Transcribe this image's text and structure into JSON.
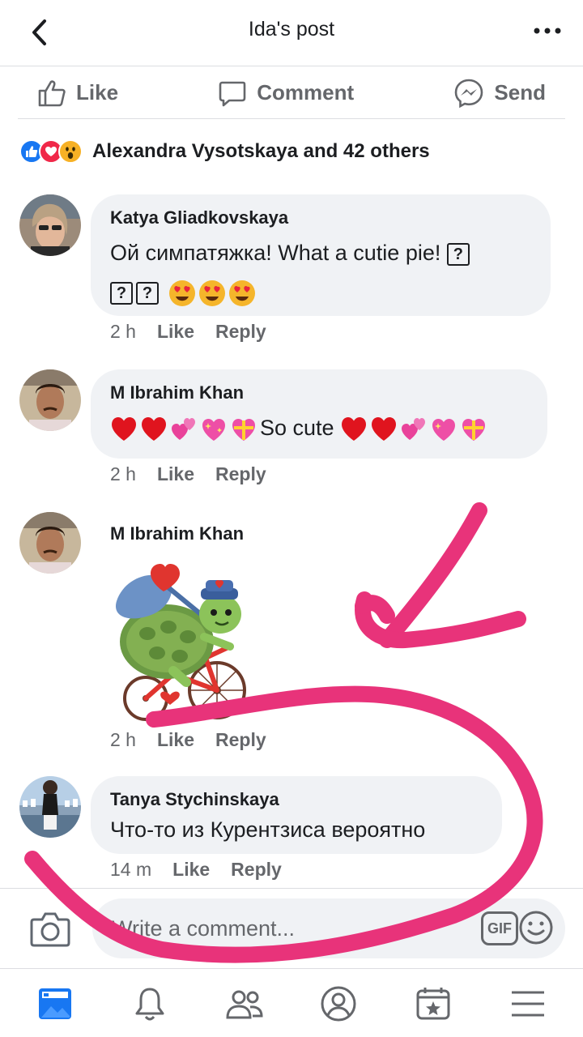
{
  "header": {
    "title": "Ida's post",
    "back_icon": "chevron-left-icon",
    "more_icon": "more-horizontal-icon"
  },
  "actions": {
    "like": "Like",
    "comment": "Comment",
    "send": "Send"
  },
  "reactions": {
    "icons": [
      "like-reaction-icon",
      "love-reaction-icon",
      "wow-reaction-icon"
    ],
    "summary": "Alexandra  Vysotskaya and 42 others"
  },
  "comments": [
    {
      "author": "Katya Gliadkovskaya",
      "text_line1": "Ой симпатяжка! What a cutie pie!",
      "time": "2 h",
      "like": "Like",
      "reply": "Reply"
    },
    {
      "author": "M Ibrahim Khan",
      "text": "So cute",
      "time": "2 h",
      "like": "Like",
      "reply": "Reply"
    },
    {
      "author": "M Ibrahim Khan",
      "sticker": "turtle-on-bicycle-sticker",
      "time": "2 h",
      "like": "Like",
      "reply": "Reply"
    },
    {
      "author": "Tanya Stychinskaya",
      "text": "Что-то из Курентзиса вероятно",
      "time": "14 m",
      "like": "Like",
      "reply": "Reply"
    }
  ],
  "composer": {
    "placeholder": "Write a comment...",
    "gif_label": "GIF"
  },
  "nav": [
    "news-feed-icon",
    "notifications-icon",
    "friends-icon",
    "profile-icon",
    "pages-icon",
    "menu-icon"
  ],
  "colors": {
    "accent": "#1877f2",
    "annotation": "#e8337a",
    "muted": "#65676b",
    "bubble": "#f0f2f5"
  }
}
